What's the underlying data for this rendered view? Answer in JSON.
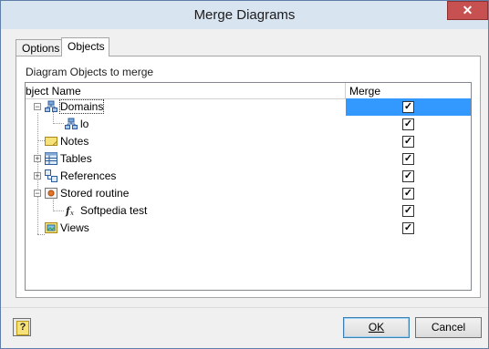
{
  "window": {
    "title": "Merge Diagrams",
    "close_glyph": "✕"
  },
  "tabs": [
    {
      "label": "Options",
      "active": false
    },
    {
      "label": "Objects",
      "active": true
    }
  ],
  "panel": {
    "group_label": "Diagram Objects to merge",
    "columns": {
      "name": "bject Name",
      "merge": "Merge"
    },
    "rows": [
      {
        "label": "Domains",
        "icon": "domains-icon",
        "checked": true,
        "expander": "−"
      },
      {
        "label": "lo",
        "icon": "domain-item-icon",
        "checked": true
      },
      {
        "label": "Notes",
        "icon": "notes-icon",
        "checked": true
      },
      {
        "label": "Tables",
        "icon": "tables-icon",
        "checked": true,
        "expander": "+"
      },
      {
        "label": "References",
        "icon": "references-icon",
        "checked": true,
        "expander": "+"
      },
      {
        "label": "Stored routine",
        "icon": "stored-routine-icon",
        "checked": true,
        "expander": "−"
      },
      {
        "label": "Softpedia test",
        "icon": "function-icon",
        "checked": true
      },
      {
        "label": "Views",
        "icon": "views-icon",
        "checked": true
      }
    ]
  },
  "buttons": {
    "help_glyph": "?",
    "ok": "OK",
    "cancel": "Cancel"
  },
  "colors": {
    "selection": "#3399ff",
    "titlebar": "#d9e4f1",
    "close": "#c75050"
  }
}
